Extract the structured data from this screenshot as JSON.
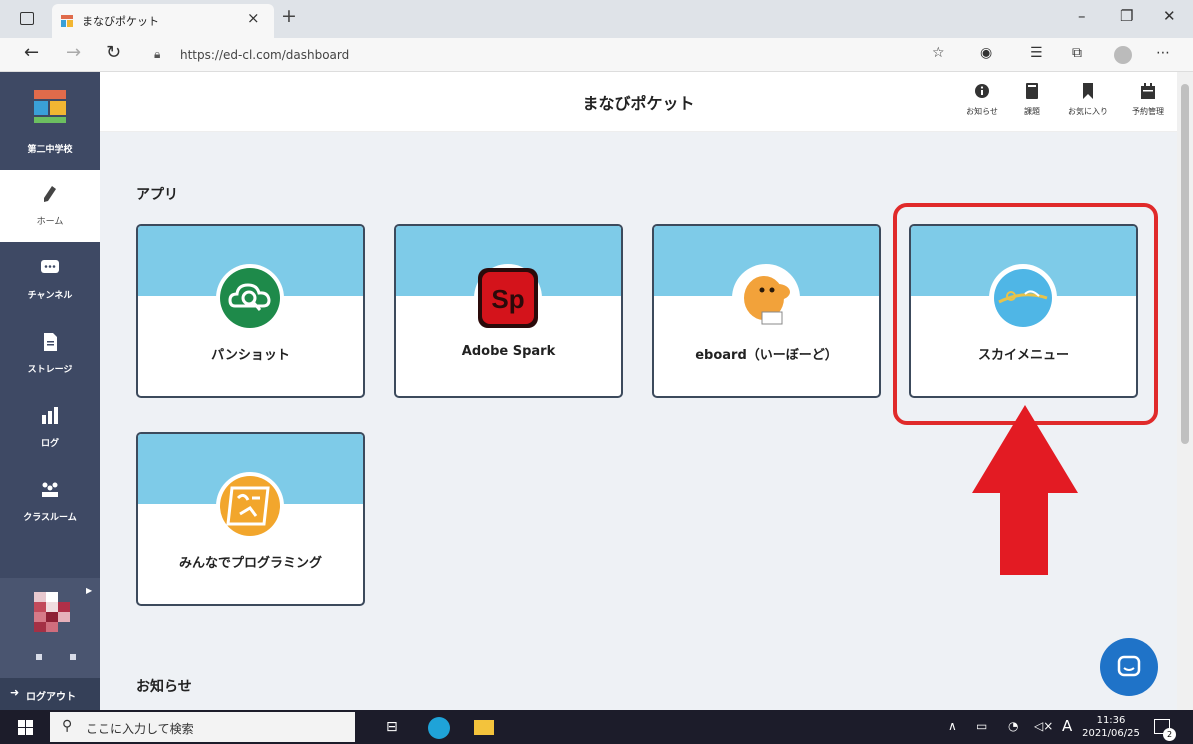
{
  "browser": {
    "tab_title": "まなびポケット",
    "tab_close": "×",
    "new_tab": "+",
    "url": "https://ed-cl.com/dashboard",
    "window_controls": [
      "–",
      "❐",
      "✕"
    ],
    "toolbar_icons": [
      "favorites-add-icon",
      "extension-icon",
      "favorites-icon",
      "collections-icon",
      "profile-icon",
      "more-icon"
    ]
  },
  "sidebar": {
    "school": "第二中学校",
    "items": [
      {
        "label": "ホーム",
        "icon": "pencil-icon"
      },
      {
        "label": "チャンネル",
        "icon": "chat-icon"
      },
      {
        "label": "ストレージ",
        "icon": "document-icon"
      },
      {
        "label": "ログ",
        "icon": "bar-chart-icon"
      },
      {
        "label": "クラスルーム",
        "icon": "classroom-icon"
      }
    ],
    "logout": "ログアウト"
  },
  "header": {
    "title": "まなびポケット",
    "buttons": [
      {
        "label": "お知らせ",
        "icon": "info-icon"
      },
      {
        "label": "課題",
        "icon": "book-icon"
      },
      {
        "label": "お気に入り",
        "icon": "bookmark-icon"
      },
      {
        "label": "予約管理",
        "icon": "calendar-icon"
      }
    ]
  },
  "main": {
    "apps_heading": "アプリ",
    "news_heading": "お知らせ",
    "apps": [
      {
        "name": "パンショット",
        "icon": "cloud-search-icon"
      },
      {
        "name": "Adobe Spark",
        "icon": "adobe-spark-icon",
        "logo_text": "Sp"
      },
      {
        "name": "eboard（いーぼーど）",
        "icon": "eboard-mascot-icon"
      },
      {
        "name": "スカイメニュー",
        "icon": "skymenu-icon"
      },
      {
        "name": "みんなでプログラミング",
        "icon": "minpro-icon"
      }
    ],
    "highlight_color": "#e02a2a"
  },
  "taskbar": {
    "search_placeholder": "ここに入力して検索",
    "ime": "A",
    "time": "11:36",
    "date": "2021/06/25",
    "notification_count": "2"
  }
}
